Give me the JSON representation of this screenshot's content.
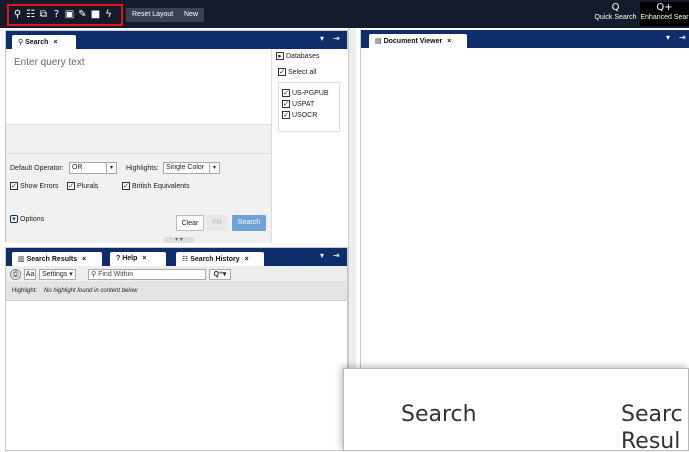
{
  "topbar": {
    "icons": [
      "search-icon",
      "search-list-icon",
      "copy-icon",
      "help-icon",
      "save-icon",
      "edit-icon",
      "square-icon",
      "bolt-icon"
    ],
    "icon_glyphs": [
      "⚲",
      "☷",
      "⧉",
      "?",
      "▣",
      "✎",
      "■",
      "ϟ"
    ],
    "reset_label": "Reset Layout",
    "new_label": "New",
    "quick_search_icon": "Q",
    "quick_search_label": "Quick Search",
    "enhanced_search_icon": "Q+",
    "enhanced_search_label": "Enhanced Sear"
  },
  "search_panel": {
    "tab_label": "Search",
    "query_placeholder": "Enter query text",
    "default_operator_label": "Default Operator:",
    "default_operator_value": "OR",
    "highlights_label": "Highlights:",
    "highlights_value": "Single Color",
    "show_errors": "Show Errors",
    "plurals": "Plurals",
    "british_equivalents": "British Equivalents",
    "options_label": "Options",
    "clear_label": "Clear",
    "pn_label": "PN",
    "search_label": "Search"
  },
  "databases": {
    "header": "Databases",
    "select_all": "Select all",
    "items": [
      "US-PGPUB",
      "USPAT",
      "USOCR"
    ]
  },
  "document_viewer": {
    "tab_label": "Document Viewer"
  },
  "results_panel": {
    "tabs": [
      "Search Results",
      "Help",
      "Search History"
    ],
    "settings_label": "Settings",
    "find_placeholder": "Find Within",
    "highlight_label": "Highlight:",
    "highlight_text": "No highlight found in content below"
  },
  "zoom_overlay": {
    "word1": "Search",
    "word2": "Searc",
    "word3": "Resul"
  },
  "colors": {
    "topbar": "#141c2b",
    "panel_header": "#0d2d6b",
    "highlight_box": "#e0151c",
    "search_button": "#6fa3d7"
  }
}
